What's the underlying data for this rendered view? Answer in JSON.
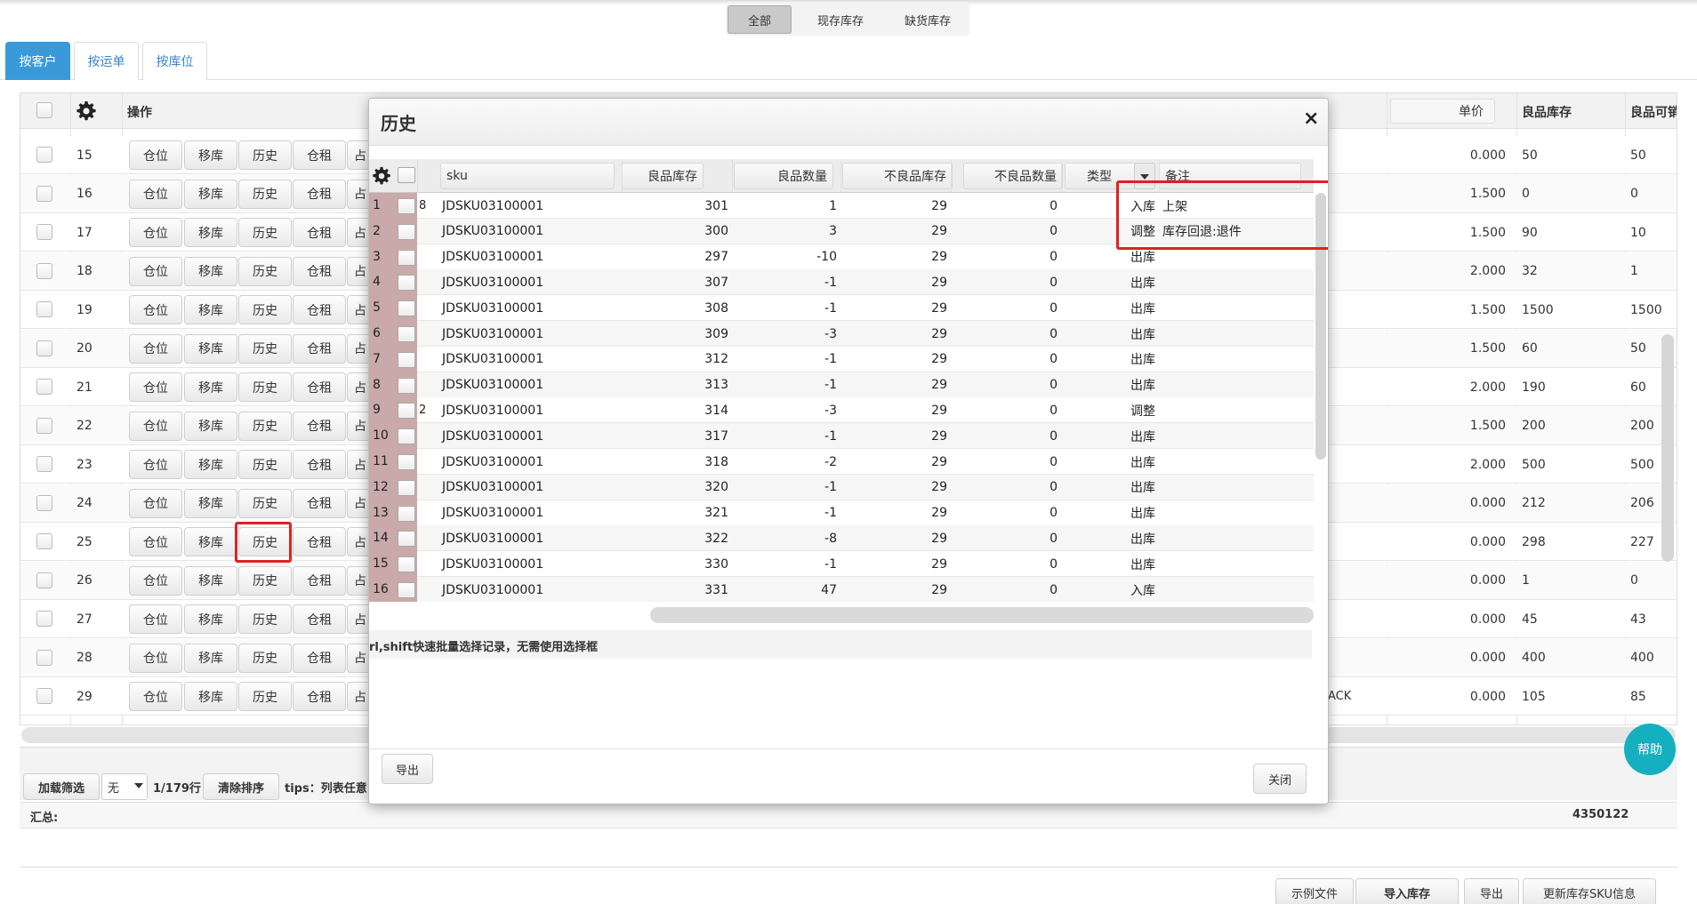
{
  "top_filter": {
    "items": [
      "全部",
      "现存库存",
      "缺货库存"
    ],
    "active": 0
  },
  "tabs": [
    "按客户",
    "按运单",
    "按库位"
  ],
  "grid": {
    "header": {
      "ops": "操作",
      "unit_price": "单价",
      "good_stock": "良品库存",
      "good_avail": "良品可销"
    },
    "row_buttons": [
      "仓位",
      "移库",
      "历史",
      "仓租",
      "占"
    ],
    "rows": [
      {
        "n": "15",
        "price": "0.000",
        "stock": "50",
        "avail": "50",
        "extra": ""
      },
      {
        "n": "16",
        "price": "1.500",
        "stock": "0",
        "avail": "0",
        "extra": ""
      },
      {
        "n": "17",
        "price": "1.500",
        "stock": "90",
        "avail": "10",
        "extra": ""
      },
      {
        "n": "18",
        "price": "2.000",
        "stock": "32",
        "avail": "1",
        "extra": ""
      },
      {
        "n": "19",
        "price": "1.500",
        "stock": "1500",
        "avail": "1500",
        "extra": ""
      },
      {
        "n": "20",
        "price": "1.500",
        "stock": "60",
        "avail": "50",
        "extra": ""
      },
      {
        "n": "21",
        "price": "2.000",
        "stock": "190",
        "avail": "60",
        "extra": ""
      },
      {
        "n": "22",
        "price": "1.500",
        "stock": "200",
        "avail": "200",
        "extra": ""
      },
      {
        "n": "23",
        "price": "2.000",
        "stock": "500",
        "avail": "500",
        "extra": ""
      },
      {
        "n": "24",
        "price": "0.000",
        "stock": "212",
        "avail": "206",
        "extra": ""
      },
      {
        "n": "25",
        "price": "0.000",
        "stock": "298",
        "avail": "227",
        "extra": ""
      },
      {
        "n": "26",
        "price": "0.000",
        "stock": "1",
        "avail": "0",
        "extra": ""
      },
      {
        "n": "27",
        "price": "0.000",
        "stock": "45",
        "avail": "43",
        "extra": ""
      },
      {
        "n": "28",
        "price": "0.000",
        "stock": "400",
        "avail": "400",
        "extra": ""
      },
      {
        "n": "29",
        "price": "0.000",
        "stock": "105",
        "avail": "85",
        "extra": "ACK"
      }
    ],
    "footer": {
      "load_filter": "加载筛选",
      "none": "无",
      "row_count": "1/179行",
      "clear_sort": "清除排序",
      "tips": "tips：列表任意",
      "summary_label": "汇总:",
      "summary_total": "4350122"
    }
  },
  "bottom_buttons": [
    "示例文件",
    "导入库存",
    "导出",
    "更新库存SKU信息"
  ],
  "help_label": "帮助",
  "modal": {
    "title": "历史",
    "close_x": "×",
    "columns": {
      "sku": "sku",
      "good_stock": "良品库存",
      "good_qty": "良品数量",
      "bad_stock": "不良品库存",
      "bad_qty": "不良品数量",
      "type": "类型",
      "remark": "备注"
    },
    "rows": [
      {
        "i": "1",
        "tag": "8",
        "sku": "JDSKU03100001",
        "gs": "301",
        "gq": "1",
        "bs": "29",
        "bq": "0",
        "type": "入库",
        "remark": "上架"
      },
      {
        "i": "2",
        "tag": "",
        "sku": "JDSKU03100001",
        "gs": "300",
        "gq": "3",
        "bs": "29",
        "bq": "0",
        "type": "调整",
        "remark": "库存回退:退件"
      },
      {
        "i": "3",
        "tag": "",
        "sku": "JDSKU03100001",
        "gs": "297",
        "gq": "-10",
        "bs": "29",
        "bq": "0",
        "type": "出库",
        "remark": ""
      },
      {
        "i": "4",
        "tag": "",
        "sku": "JDSKU03100001",
        "gs": "307",
        "gq": "-1",
        "bs": "29",
        "bq": "0",
        "type": "出库",
        "remark": ""
      },
      {
        "i": "5",
        "tag": "",
        "sku": "JDSKU03100001",
        "gs": "308",
        "gq": "-1",
        "bs": "29",
        "bq": "0",
        "type": "出库",
        "remark": ""
      },
      {
        "i": "6",
        "tag": "",
        "sku": "JDSKU03100001",
        "gs": "309",
        "gq": "-3",
        "bs": "29",
        "bq": "0",
        "type": "出库",
        "remark": ""
      },
      {
        "i": "7",
        "tag": "",
        "sku": "JDSKU03100001",
        "gs": "312",
        "gq": "-1",
        "bs": "29",
        "bq": "0",
        "type": "出库",
        "remark": ""
      },
      {
        "i": "8",
        "tag": "",
        "sku": "JDSKU03100001",
        "gs": "313",
        "gq": "-1",
        "bs": "29",
        "bq": "0",
        "type": "出库",
        "remark": ""
      },
      {
        "i": "9",
        "tag": "2",
        "sku": "JDSKU03100001",
        "gs": "314",
        "gq": "-3",
        "bs": "29",
        "bq": "0",
        "type": "调整",
        "remark": ""
      },
      {
        "i": "10",
        "tag": "",
        "sku": "JDSKU03100001",
        "gs": "317",
        "gq": "-1",
        "bs": "29",
        "bq": "0",
        "type": "出库",
        "remark": ""
      },
      {
        "i": "11",
        "tag": "",
        "sku": "JDSKU03100001",
        "gs": "318",
        "gq": "-2",
        "bs": "29",
        "bq": "0",
        "type": "出库",
        "remark": ""
      },
      {
        "i": "12",
        "tag": "",
        "sku": "JDSKU03100001",
        "gs": "320",
        "gq": "-1",
        "bs": "29",
        "bq": "0",
        "type": "出库",
        "remark": ""
      },
      {
        "i": "13",
        "tag": "",
        "sku": "JDSKU03100001",
        "gs": "321",
        "gq": "-1",
        "bs": "29",
        "bq": "0",
        "type": "出库",
        "remark": ""
      },
      {
        "i": "14",
        "tag": "",
        "sku": "JDSKU03100001",
        "gs": "322",
        "gq": "-8",
        "bs": "29",
        "bq": "0",
        "type": "出库",
        "remark": ""
      },
      {
        "i": "15",
        "tag": "",
        "sku": "JDSKU03100001",
        "gs": "330",
        "gq": "-1",
        "bs": "29",
        "bq": "0",
        "type": "出库",
        "remark": ""
      },
      {
        "i": "16",
        "tag": "",
        "sku": "JDSKU03100001",
        "gs": "331",
        "gq": "47",
        "bs": "29",
        "bq": "0",
        "type": "入库",
        "remark": ""
      }
    ],
    "tip": "rl,shift快速批量选择记录，无需使用选择框",
    "export_label": "导出",
    "close_label": "关闭"
  }
}
